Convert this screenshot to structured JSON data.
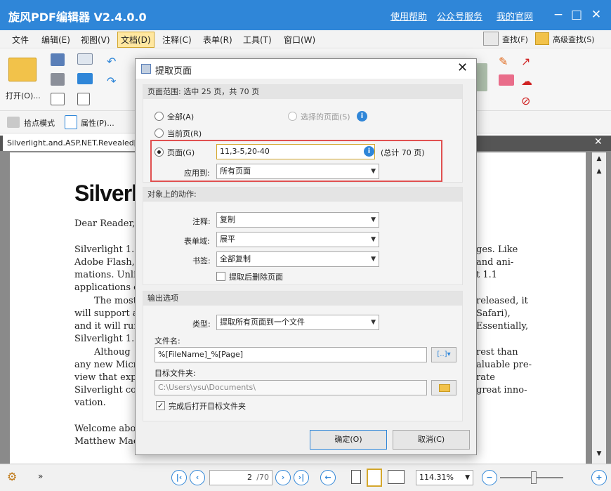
{
  "titlebar": {
    "title": "旋风PDF编辑器 V2.4.0.0",
    "links": [
      "使用帮助",
      "公众号服务",
      "我的官网"
    ]
  },
  "menubar": {
    "items": [
      "文件",
      "编辑(E)",
      "视图(V)",
      "文档(D)",
      "注释(C)",
      "表单(R)",
      "工具(T)",
      "窗口(W)"
    ],
    "active_index": 3,
    "find_label": "查找(F)",
    "advanced_find_label": "高级查找(S)"
  },
  "ribbon": {
    "open_label": "打开(O)..."
  },
  "toolbar2": {
    "pick_mode_label": "拾点模式",
    "properties_label": "属性(P)..."
  },
  "document_tab": {
    "title": "Silverlight.and.ASP.NET.Revealed["
  },
  "document": {
    "heading": "Silverl",
    "left_lines": [
      "Dear Reader,",
      "Silverlight 1.1",
      "Adobe Flash, S",
      "mations. Unli",
      "applications c",
      "The most",
      "will support a",
      "and it will run",
      "Silverlight 1.1",
      "Althoug",
      "any new Micr",
      "view that expl",
      "Silverlight con",
      "vation.",
      "Welcome abo",
      "Matthew Mac"
    ],
    "right_lines": [
      "ges. Like",
      "and ani-",
      "t 1.1",
      "released, it",
      "Safari),",
      "Essentially,",
      "rest than",
      "aluable pre-",
      "rate",
      "great inno-"
    ]
  },
  "dialog": {
    "title": "提取页面",
    "page_range_header": "页面范围: 选中 25 页，共 70 页",
    "radio_all": "全部(A)",
    "radio_selected": "选择的页面(S)",
    "radio_current": "当前页(R)",
    "radio_pages": "页面(G)",
    "pages_value": "11,3-5,20-40",
    "total_pages": "(总计 70 页)",
    "apply_to_label": "应用到:",
    "apply_to_value": "所有页面",
    "actions_header": "对象上的动作:",
    "annotations_label": "注释:",
    "annotations_value": "复制",
    "forms_label": "表单域:",
    "forms_value": "展平",
    "bookmarks_label": "书签:",
    "bookmarks_value": "全部复制",
    "delete_after_label": "提取后删除页面",
    "output_header": "输出选项",
    "type_label": "类型:",
    "type_value": "提取所有页面到一个文件",
    "filename_label": "文件名:",
    "filename_value": "%[FileName]_%[Page]",
    "target_folder_label": "目标文件夹:",
    "target_folder_value": "C:\\Users\\ysu\\Documents\\",
    "open_folder_label": "完成后打开目标文件夹",
    "ok_label": "确定(O)",
    "cancel_label": "取消(C)"
  },
  "statusbar": {
    "page_input": "2",
    "page_total": "/70",
    "zoom": "114.31%"
  },
  "colors": {
    "titlebar": "#2f86d8",
    "highlight_border": "#e05050",
    "active_menu": "#ffe7a0"
  }
}
